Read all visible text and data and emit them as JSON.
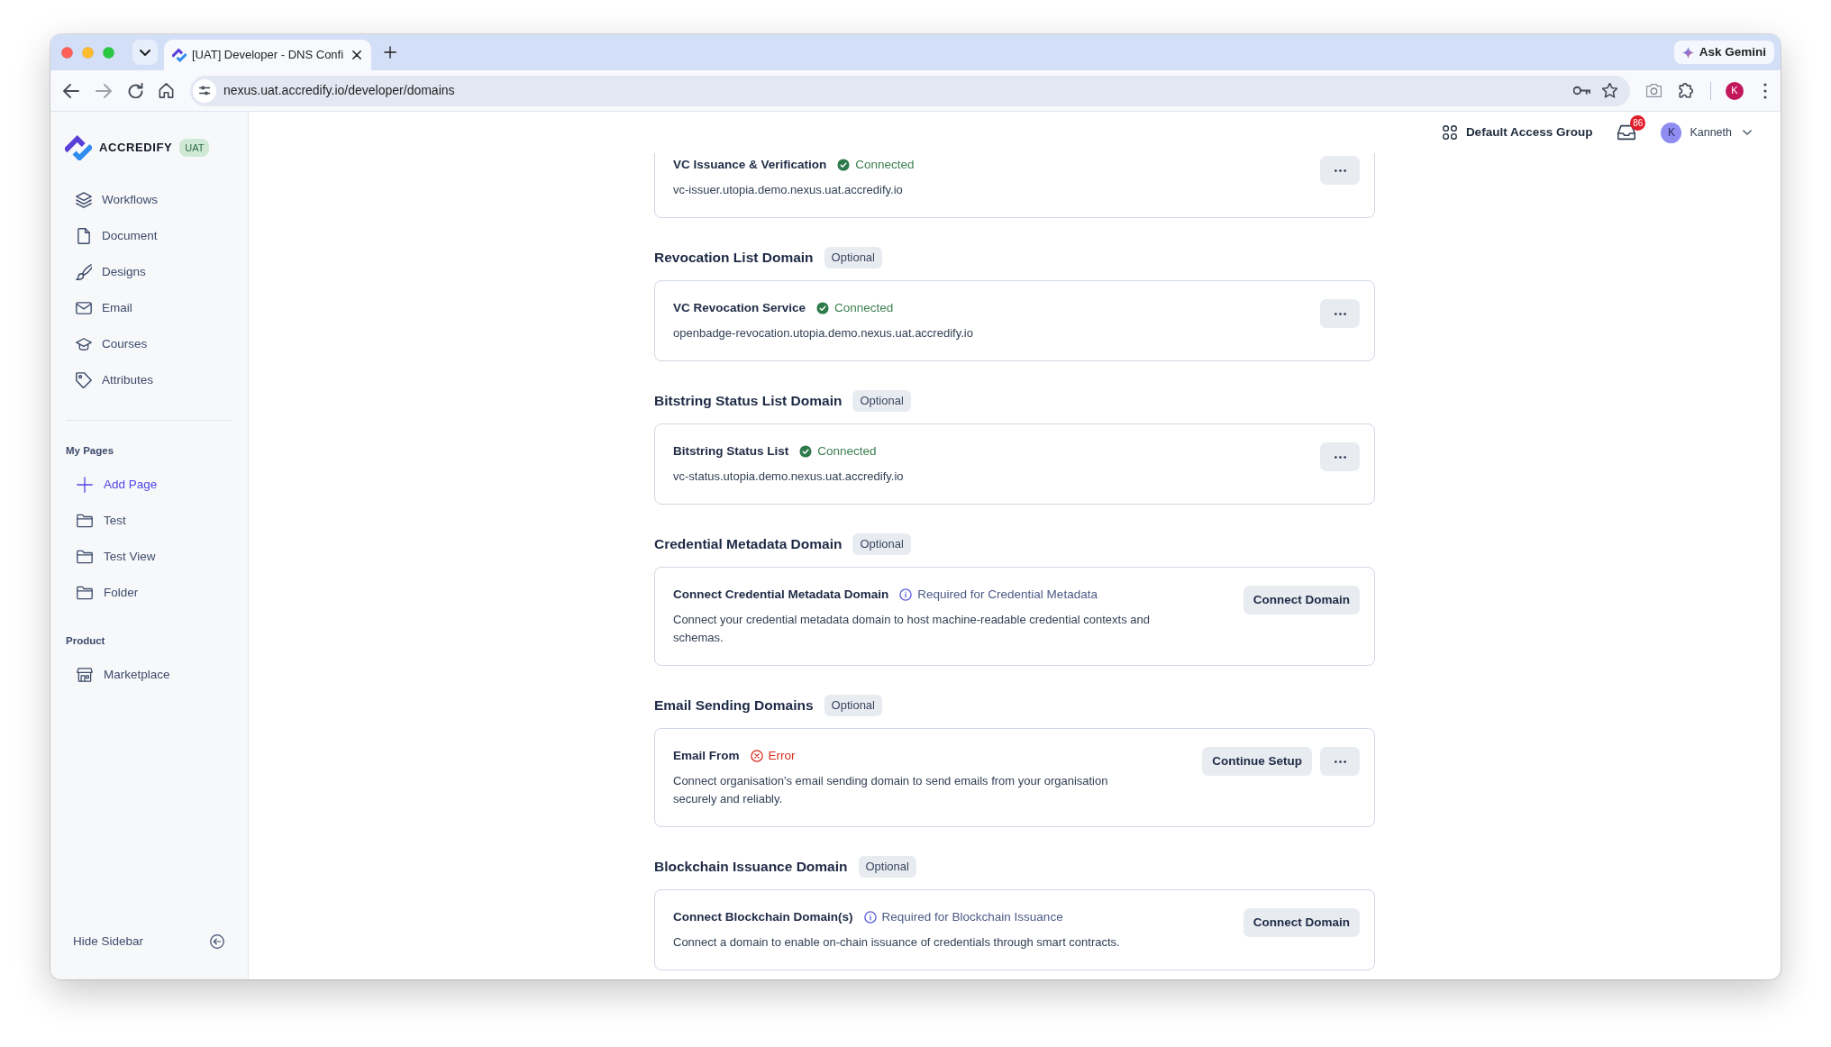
{
  "browser": {
    "tab": {
      "title": "[UAT] Developer - DNS Confi",
      "selected": true
    },
    "ask_gemini": "Ask Gemini",
    "url": "nexus.uat.accredify.io/developer/domains",
    "profile_initial": "K"
  },
  "sidebar": {
    "brand": "ACCREDIFY",
    "env_badge": "UAT",
    "nav_items": [
      {
        "label": "Workflows"
      },
      {
        "label": "Document"
      },
      {
        "label": "Designs"
      },
      {
        "label": "Email"
      },
      {
        "label": "Courses"
      },
      {
        "label": "Attributes"
      }
    ],
    "groups": [
      {
        "title": "My Pages",
        "items": [
          {
            "kind": "add",
            "label": "Add Page"
          },
          {
            "kind": "folder",
            "label": "Test"
          },
          {
            "kind": "folder",
            "label": "Test View"
          },
          {
            "kind": "folder",
            "label": "Folder"
          }
        ]
      },
      {
        "title": "Product",
        "items": [
          {
            "kind": "store",
            "label": "Marketplace"
          }
        ]
      }
    ],
    "hide_sidebar": "Hide Sidebar"
  },
  "header": {
    "access_group": "Default Access Group",
    "inbox_count": "86",
    "user": {
      "initial": "K",
      "name": "Kanneth"
    }
  },
  "sections": [
    {
      "cards": [
        {
          "title": "VC Issuance & Verification",
          "status": {
            "kind": "connected",
            "label": "Connected"
          },
          "domain": "vc-issuer.utopia.demo.nexus.uat.accredify.io",
          "actions": [
            {
              "kind": "more"
            }
          ]
        }
      ]
    },
    {
      "title": "Revocation List Domain",
      "badge": "Optional",
      "cards": [
        {
          "title": "VC Revocation Service",
          "status": {
            "kind": "connected",
            "label": "Connected"
          },
          "domain": "openbadge-revocation.utopia.demo.nexus.uat.accredify.io",
          "actions": [
            {
              "kind": "more"
            }
          ]
        }
      ]
    },
    {
      "title": "Bitstring Status List Domain",
      "badge": "Optional",
      "cards": [
        {
          "title": "Bitstring Status List",
          "status": {
            "kind": "connected",
            "label": "Connected"
          },
          "domain": "vc-status.utopia.demo.nexus.uat.accredify.io",
          "actions": [
            {
              "kind": "more"
            }
          ]
        }
      ]
    },
    {
      "title": "Credential Metadata Domain",
      "badge": "Optional",
      "cards": [
        {
          "title": "Connect Credential Metadata Domain",
          "status": {
            "kind": "info",
            "label": "Required for Credential Metadata"
          },
          "description": "Connect your credential metadata domain to host machine-readable credential contexts and schemas.",
          "actions": [
            {
              "kind": "button",
              "label": "Connect Domain"
            }
          ]
        }
      ]
    },
    {
      "title": "Email Sending Domains",
      "badge": "Optional",
      "cards": [
        {
          "title": "Email From",
          "status": {
            "kind": "error",
            "label": "Error"
          },
          "description": "Connect organisation’s email sending domain to send emails from your organisation securely and reliably.",
          "actions": [
            {
              "kind": "button",
              "label": "Continue Setup"
            },
            {
              "kind": "more"
            }
          ]
        }
      ]
    },
    {
      "title": "Blockchain Issuance Domain",
      "badge": "Optional",
      "cards": [
        {
          "title": "Connect Blockchain Domain(s)",
          "status": {
            "kind": "info",
            "label": "Required for Blockchain Issuance"
          },
          "description": "Connect a domain to enable on-chain issuance of credentials through smart contracts.",
          "actions": [
            {
              "kind": "button",
              "label": "Connect Domain"
            }
          ]
        }
      ]
    }
  ]
}
